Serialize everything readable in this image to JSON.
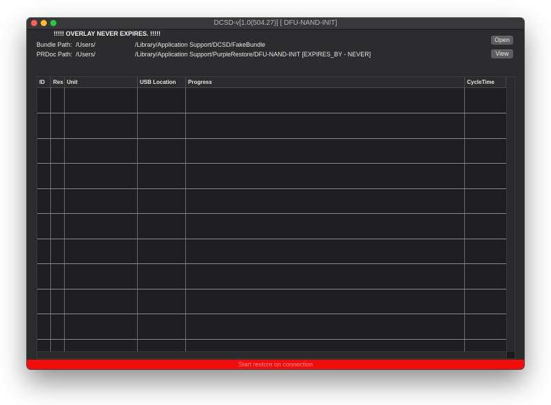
{
  "window": {
    "title": "DCSD-v[1.0(504.27)] [ DFU-NAND-INIT]"
  },
  "overlay_message": "!!!!! OVERLAY NEVER EXPIRES. !!!!!",
  "paths": {
    "bundle": {
      "label": "Bundle Path:",
      "user": "/Users/",
      "value": "/Library/Application Support/DCSD/FakeBundle"
    },
    "prdoc": {
      "label": "PRDoc Path:",
      "user": "/Users/",
      "value": "/Library/Application Support/PurpleRestore/DFU-NAND-INIT [EXPIRES_BY - NEVER]"
    }
  },
  "buttons": {
    "open": "Open",
    "view": "View"
  },
  "table": {
    "columns": [
      "ID",
      "Res",
      "Unit",
      "USB Location",
      "Progress",
      "CycleTime"
    ],
    "rows": []
  },
  "status_bar": {
    "text": "Start restore on connection",
    "color": "#f20d0d"
  },
  "colors": {
    "window_bg": "#2c2c2e",
    "close": "#fe5f57",
    "minimize": "#febc2e",
    "maximize": "#28c840"
  }
}
